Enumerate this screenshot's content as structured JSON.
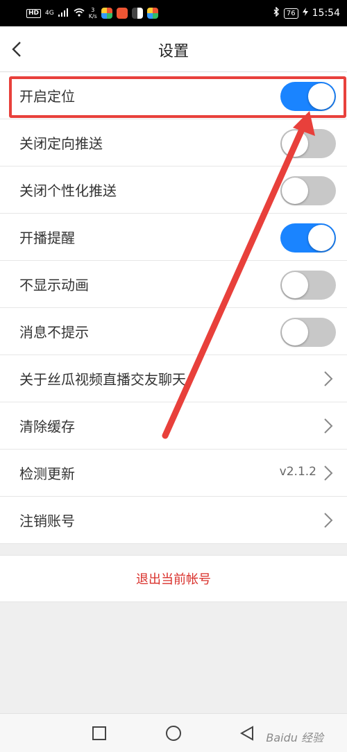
{
  "status_bar": {
    "hd": "HD",
    "network": "4G",
    "speed_value": "3",
    "speed_unit": "K/s",
    "battery": "76",
    "time": "15:54"
  },
  "header": {
    "title": "设置"
  },
  "settings": [
    {
      "label": "开启定位",
      "type": "toggle",
      "on": true
    },
    {
      "label": "关闭定向推送",
      "type": "toggle",
      "on": false
    },
    {
      "label": "关闭个性化推送",
      "type": "toggle",
      "on": false
    },
    {
      "label": "开播提醒",
      "type": "toggle",
      "on": true
    },
    {
      "label": "不显示动画",
      "type": "toggle",
      "on": false
    },
    {
      "label": "消息不提示",
      "type": "toggle",
      "on": false
    },
    {
      "label": "关于丝瓜视频直播交友聊天",
      "type": "link"
    },
    {
      "label": "清除缓存",
      "type": "link"
    },
    {
      "label": "检测更新",
      "type": "link",
      "value": "v2.1.2"
    },
    {
      "label": "注销账号",
      "type": "link"
    }
  ],
  "logout": {
    "label": "退出当前帐号"
  },
  "watermark": "Baidu 经验",
  "colors": {
    "toggle_on": "#1a84ff",
    "toggle_off": "#c8c8c8",
    "logout_text": "#d9302b",
    "annotation": "#e8403b"
  }
}
